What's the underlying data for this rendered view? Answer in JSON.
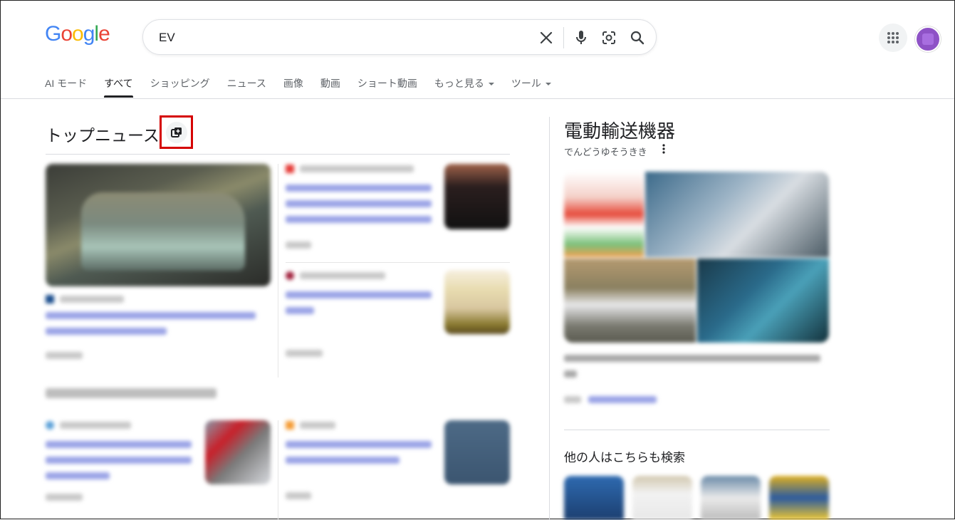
{
  "logo": {
    "text": "Google"
  },
  "search": {
    "value": "EV"
  },
  "tabs": [
    {
      "label": "AI モード"
    },
    {
      "label": "すべて"
    },
    {
      "label": "ショッピング"
    },
    {
      "label": "ニュース"
    },
    {
      "label": "画像"
    },
    {
      "label": "動画"
    },
    {
      "label": "ショート動画"
    },
    {
      "label": "もっと見る"
    },
    {
      "label": "ツール"
    }
  ],
  "top_news": {
    "title": "トップニュース"
  },
  "knowledge_panel": {
    "title": "電動輸送機器",
    "subtitle": "でんどうゆそうきき",
    "others_title": "他の人はこちらも検索"
  },
  "colors": {
    "accent_red": "#d50000",
    "link_blue": "#1a0dab",
    "avatar_purple": "#8e52c6"
  }
}
